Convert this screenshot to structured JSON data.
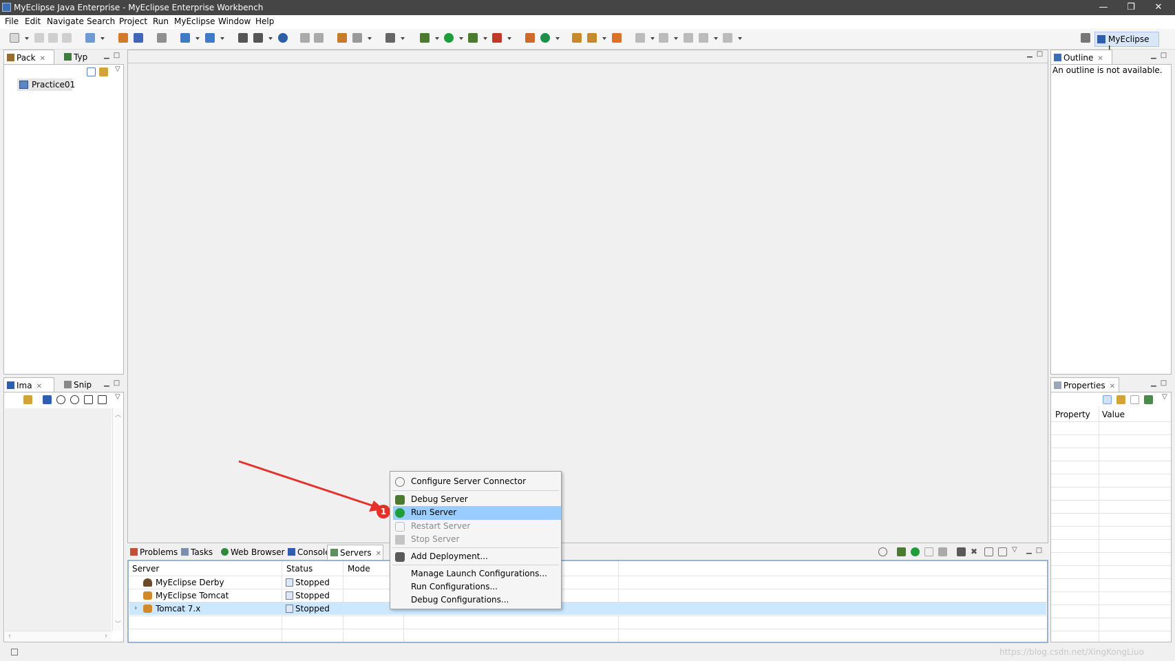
{
  "window": {
    "title": "MyEclipse Java Enterprise - MyEclipse Enterprise Workbench",
    "controls": [
      "—",
      "❐",
      "✕"
    ]
  },
  "menubar": [
    "File",
    "Edit",
    "Navigate",
    "Search",
    "Project",
    "Run",
    "MyEclipse",
    "Window",
    "Help"
  ],
  "perspective": {
    "label": "MyEclipse J..."
  },
  "left_top_panel": {
    "tabs": [
      {
        "label": "Pack",
        "icon": "package-explorer-icon"
      },
      {
        "label": "Typ",
        "icon": "type-hierarchy-icon"
      }
    ],
    "tree": [
      {
        "label": "Practice01",
        "icon": "project-folder-icon"
      }
    ]
  },
  "left_bottom_panel": {
    "tabs": [
      {
        "label": "Ima",
        "icon": "image-preview-icon"
      },
      {
        "label": "Snip",
        "icon": "snippets-icon"
      }
    ]
  },
  "outline": {
    "tab": "Outline",
    "message": "An outline is not available."
  },
  "properties": {
    "tab": "Properties",
    "columns": [
      "Property",
      "Value"
    ]
  },
  "bottom_panel": {
    "tabs": [
      {
        "label": "Problems",
        "icon": "problems-icon"
      },
      {
        "label": "Tasks",
        "icon": "tasks-icon"
      },
      {
        "label": "Web Browser",
        "icon": "globe-icon"
      },
      {
        "label": "Console",
        "icon": "console-icon"
      },
      {
        "label": "Servers",
        "icon": "servers-icon"
      }
    ],
    "active_tab": "Servers",
    "servers_table": {
      "columns": [
        "Server",
        "Status",
        "Mode"
      ],
      "rows": [
        {
          "server": "MyEclipse Derby",
          "status": "Stopped",
          "mode": ""
        },
        {
          "server": "MyEclipse Tomcat",
          "status": "Stopped",
          "mode": ""
        },
        {
          "server": "Tomcat  7.x",
          "status": "Stopped",
          "mode": ""
        }
      ]
    }
  },
  "context_menu": {
    "items": [
      {
        "label": "Configure Server Connector",
        "icon": "connector-icon",
        "state": "enabled"
      },
      {
        "label": "Debug Server",
        "icon": "bug-icon",
        "state": "enabled"
      },
      {
        "label": "Run Server",
        "icon": "play-icon",
        "state": "selected"
      },
      {
        "label": "Restart Server",
        "icon": "restart-icon",
        "state": "disabled"
      },
      {
        "label": "Stop Server",
        "icon": "stop-icon",
        "state": "disabled"
      },
      {
        "label": "Add Deployment...",
        "icon": "deploy-icon",
        "state": "enabled"
      },
      {
        "label": "Manage Launch Configurations...",
        "icon": "",
        "state": "enabled"
      },
      {
        "label": "Run Configurations...",
        "icon": "",
        "state": "enabled"
      },
      {
        "label": "Debug Configurations...",
        "icon": "",
        "state": "enabled"
      }
    ]
  },
  "annotation": {
    "badge": "1",
    "arrow_color": "#e8302b"
  },
  "watermark": "https://blog.csdn.net/XingKongLiuo",
  "colors": {
    "selection": "#99ccff",
    "row_selection": "#cce8ff",
    "title_bar": "#454545",
    "run_green": "#1e9e3a"
  }
}
